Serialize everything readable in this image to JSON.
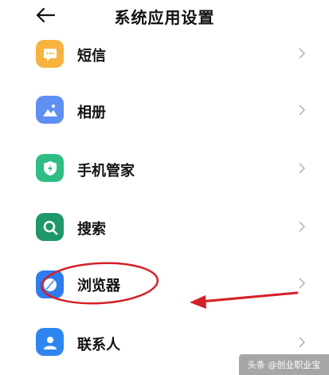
{
  "header": {
    "title": "系统应用设置",
    "back_icon": "arrow-left-icon"
  },
  "items": [
    {
      "label": "短信",
      "icon": "message-icon",
      "color": "#F7B33F"
    },
    {
      "label": "相册",
      "icon": "gallery-icon",
      "color": "#5E8FF2"
    },
    {
      "label": "手机管家",
      "icon": "shield-icon",
      "color": "#2EBD85"
    },
    {
      "label": "搜索",
      "icon": "search-icon",
      "color": "#1E9868"
    },
    {
      "label": "浏览器",
      "icon": "browser-icon",
      "color": "#2E7CEF"
    },
    {
      "label": "联系人",
      "icon": "contacts-icon",
      "color": "#2D86F0"
    }
  ],
  "annotation_color": "#D32127",
  "watermark": "头条 @创业职业宝"
}
